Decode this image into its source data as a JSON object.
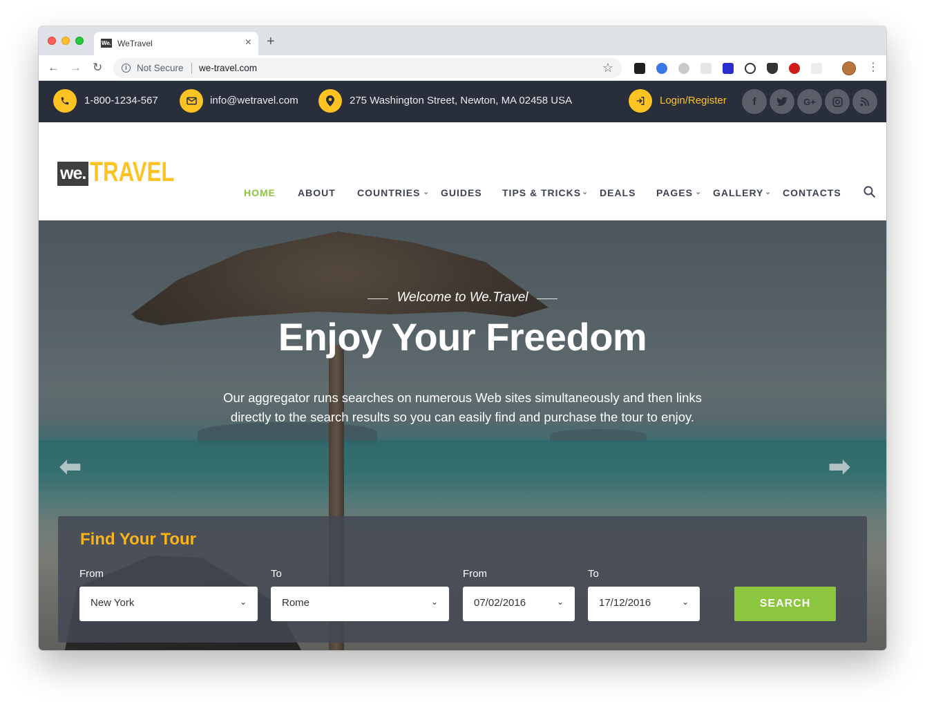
{
  "browser": {
    "tab_title": "WeTravel",
    "favicon_text": "We.",
    "url_security": "Not Secure",
    "url": "we-travel.com"
  },
  "topbar": {
    "phone": "1-800-1234-567",
    "email": "info@wetravel.com",
    "address": "275 Washington Street, Newton, MA 02458 USA",
    "login": "Login/Register",
    "social": [
      "f",
      "t",
      "G+",
      "ig",
      "rss"
    ]
  },
  "logo": {
    "we": "we.",
    "travel": "TRAVEL"
  },
  "nav": {
    "items": [
      {
        "label": "HOME",
        "active": true,
        "dropdown": false
      },
      {
        "label": "ABOUT",
        "active": false,
        "dropdown": false
      },
      {
        "label": "COUNTRIES",
        "active": false,
        "dropdown": true
      },
      {
        "label": "GUIDES",
        "active": false,
        "dropdown": false
      },
      {
        "label": "TIPS & TRICKS",
        "active": false,
        "dropdown": true
      },
      {
        "label": "DEALS",
        "active": false,
        "dropdown": false
      },
      {
        "label": "PAGES",
        "active": false,
        "dropdown": true
      },
      {
        "label": "GALLERY",
        "active": false,
        "dropdown": true
      },
      {
        "label": "CONTACTS",
        "active": false,
        "dropdown": false
      }
    ]
  },
  "hero": {
    "welcome": "Welcome to We.Travel",
    "title": "Enjoy Your Freedom",
    "description": "Our aggregator runs searches on numerous Web sites simultaneously and then links directly to the search results so you can easily find and purchase the tour to enjoy."
  },
  "tour_search": {
    "title": "Find Your Tour",
    "fields": [
      {
        "label": "From",
        "value": "New York"
      },
      {
        "label": "To",
        "value": "Rome"
      },
      {
        "label": "From",
        "value": "07/02/2016"
      },
      {
        "label": "To",
        "value": "17/12/2016"
      }
    ],
    "button": "SEARCH"
  },
  "colors": {
    "accent_yellow": "#fdc323",
    "accent_green": "#8cc63f",
    "topbar_bg": "#292e3b",
    "tour_title": "#fdb516"
  }
}
